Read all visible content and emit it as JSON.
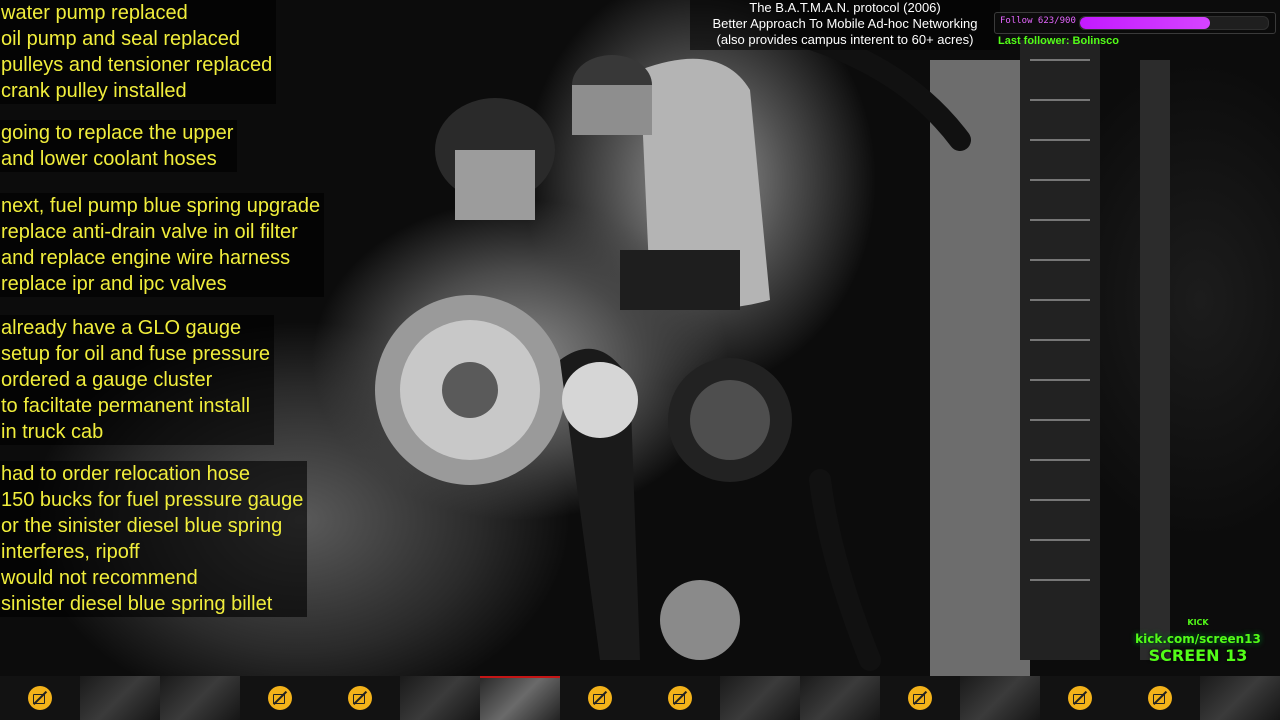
{
  "notes": [
    [
      "water pump replaced",
      "oil pump and seal replaced",
      "pulleys and tensioner replaced",
      "crank pulley installed"
    ],
    [
      "going to replace the upper",
      "and lower coolant hoses"
    ],
    [
      "next, fuel pump blue spring upgrade",
      "replace anti-drain valve in oil filter",
      "and replace engine wire harness",
      "replace ipr and ipc valves"
    ],
    [
      "already have a GLO gauge",
      "setup for oil and fuse pressure",
      "ordered a gauge cluster",
      "to faciltate permanent install",
      "in truck cab"
    ],
    [
      "had to order relocation hose",
      "150 bucks for fuel pressure gauge",
      "or the sinister diesel blue spring",
      "interferes, ripoff",
      "would not recommend",
      "sinister diesel blue spring billet"
    ]
  ],
  "caption": {
    "line1": "The B.A.T.M.A.N. protocol (2006)",
    "line2": "Better Approach To Mobile Ad-hoc Networking",
    "line3": "(also provides campus interent to 60+ acres)"
  },
  "follow": {
    "label": "Follow 623/900",
    "current": 623,
    "goal": 900,
    "last_follower": "Last follower: Bolinsco"
  },
  "kick": {
    "small": "KICK",
    "url": "kick.com/screen13",
    "name": "SCREEN 13"
  },
  "camera_strip": [
    {
      "state": "off",
      "icon": "camera-off-icon"
    },
    {
      "state": "live"
    },
    {
      "state": "live"
    },
    {
      "state": "off",
      "icon": "camera-off-icon"
    },
    {
      "state": "off",
      "icon": "camera-off-icon"
    },
    {
      "state": "live"
    },
    {
      "state": "active"
    },
    {
      "state": "off",
      "icon": "camera-off-icon"
    },
    {
      "state": "off",
      "icon": "camera-off-icon"
    },
    {
      "state": "live"
    },
    {
      "state": "live"
    },
    {
      "state": "off",
      "icon": "camera-off-icon"
    },
    {
      "state": "live"
    },
    {
      "state": "off",
      "icon": "camera-off-icon"
    },
    {
      "state": "off",
      "icon": "camera-off-icon"
    },
    {
      "state": "live"
    }
  ],
  "colors": {
    "note_text": "#f1ee3c",
    "follow_accent": "#c31aff",
    "kick_green": "#53fc18",
    "active_cam_border": "#c41616",
    "cam_off_badge": "#f3b21a"
  }
}
